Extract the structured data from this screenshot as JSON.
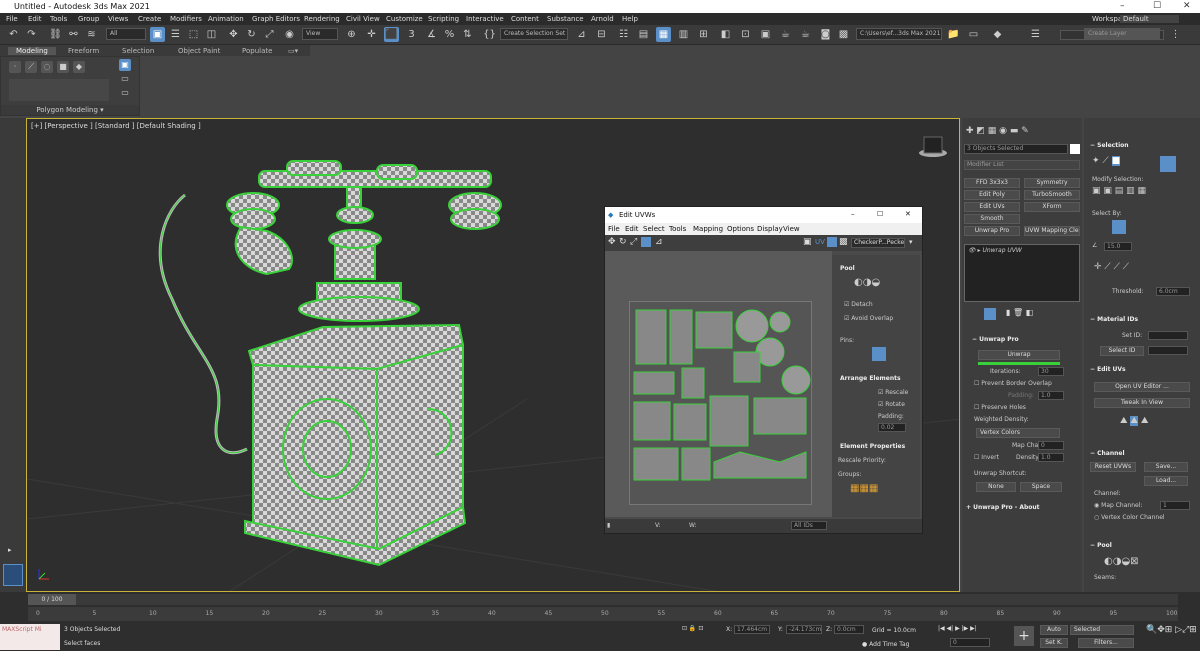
{
  "window": {
    "title": "Untitled - Autodesk 3ds Max 2021",
    "minimize": "–",
    "maximize": "☐",
    "close": "✕"
  },
  "menu": [
    "File",
    "Edit",
    "Tools",
    "Group",
    "Views",
    "Create",
    "Modifiers",
    "Animation",
    "Graph Editors",
    "Rendering",
    "Civil View",
    "Customize",
    "Scripting",
    "Interactive",
    "Content",
    "Substance",
    "Arnold",
    "Help"
  ],
  "workspace": {
    "label": "Workspaces:",
    "value": "Default"
  },
  "toolbar": {
    "filter": "All",
    "view": "View",
    "selection_set": "Create Selection Set",
    "path": "C:\\Users\\ef...3ds Max 2021",
    "layer_field": "Create Layer"
  },
  "ribbon": {
    "tabs": [
      "Modeling",
      "Freeform",
      "Selection",
      "Object Paint",
      "Populate"
    ],
    "active_tab": "Modeling",
    "group_label": "Polygon Modeling"
  },
  "viewport": {
    "label": "[+] [Perspective ] [Standard ] [Default Shading ]"
  },
  "uvw_editor": {
    "title": "Edit UVWs",
    "menu": [
      "File",
      "Edit",
      "Select",
      "Tools",
      "Mapping",
      "Options",
      "Display",
      "View"
    ],
    "toolbar_uv": "UV",
    "checker": "CheckerP...Pecker",
    "pool_title": "Pool",
    "detach": "Detach",
    "avoid_overlap": "Avoid Overlap",
    "pins": "Pins:",
    "arrange_title": "Arrange Elements",
    "rescale": "Rescale",
    "rotate": "Rotate",
    "padding_label": "Padding:",
    "padding": "0.02",
    "element_props_title": "Element Properties",
    "rescale_priority": "Rescale Priority:",
    "groups": "Groups:",
    "bottom": {
      "u": "U:",
      "v": "V:",
      "w": "W:",
      "ids": "All IDs",
      "zoom": "6.0",
      "xy": "XY",
      "grid": "16"
    }
  },
  "command_panel": {
    "object_name": "3 Objects Selected",
    "modifier_list": "Modifier List",
    "modifier_buttons": [
      [
        "FFD 3x3x3",
        "Symmetry"
      ],
      [
        "Edit Poly",
        "TurboSmooth"
      ],
      [
        "Edit UVs",
        "XForm"
      ],
      [
        "Smooth",
        ""
      ],
      [
        "Unwrap Pro",
        "UVW Mapping Clear"
      ]
    ],
    "stack_item": "Unwrap UVW",
    "unwrap_pro": {
      "title": "Unwrap Pro",
      "unwrap": "Unwrap",
      "iterations_label": "Iterations:",
      "iterations": "30",
      "prevent_border_overlap": "Prevent Border Overlap",
      "padding_label": "Padding:",
      "padding": "1.0",
      "preserve_holes": "Preserve Holes",
      "weighted_density": "Weighted Density:",
      "vertex_colors": "Vertex Colors",
      "map_channel_label": "Map Channel:",
      "map_channel": "0",
      "invert": "Invert",
      "density_label": "Density:",
      "density": "1.0",
      "shortcut_label": "Unwrap Shortcut:",
      "shortcut_a": "None",
      "shortcut_b": "Space",
      "about": "Unwrap Pro - About"
    }
  },
  "right_panel": {
    "selection_title": "Selection",
    "modify_selection": "Modify Selection:",
    "select_by": "Select By:",
    "angle": "15.0",
    "threshold_label": "Threshold:",
    "threshold": "6.0cm",
    "material_ids": "Material IDs",
    "set_id": "Set ID:",
    "select_id": "Select ID",
    "edit_uvs": "Edit UVs",
    "open_uv_editor": "Open UV Editor ...",
    "tweak_in_view": "Tweak In View",
    "channel": "Channel",
    "reset_uvws": "Reset UVWs",
    "save": "Save...",
    "load": "Load...",
    "channel_label": "Channel:",
    "map_channel": "Map Channel:",
    "map_channel_value": "1",
    "vertex_color_channel": "Vertex Color Channel",
    "pool": "Pool",
    "seams": "Seams:"
  },
  "timeline": {
    "frame": "0 / 100",
    "ticks": [
      "0",
      "5",
      "10",
      "15",
      "20",
      "25",
      "30",
      "35",
      "40",
      "45",
      "50",
      "55",
      "60",
      "65",
      "70",
      "75",
      "80",
      "85",
      "90",
      "95",
      "100"
    ]
  },
  "status": {
    "script": "MAXScript Mi",
    "objects": "3 Objects Selected",
    "prompt": "Select faces",
    "x": "X:",
    "y": "Y:",
    "z": "Z:",
    "x_val": "17.464cm",
    "y_val": "-24.173cm",
    "z_val": "0.0cm",
    "grid": "Grid = 10.0cm",
    "add_time_tag": "Add Time Tag",
    "auto": "Auto",
    "selected": "Selected",
    "set_k": "Set K.",
    "filters": "Filters...",
    "frame": "0"
  },
  "colors": {
    "accent": "#5b8fc7",
    "green": "#39d139",
    "viewport_border": "#c8b43a"
  }
}
